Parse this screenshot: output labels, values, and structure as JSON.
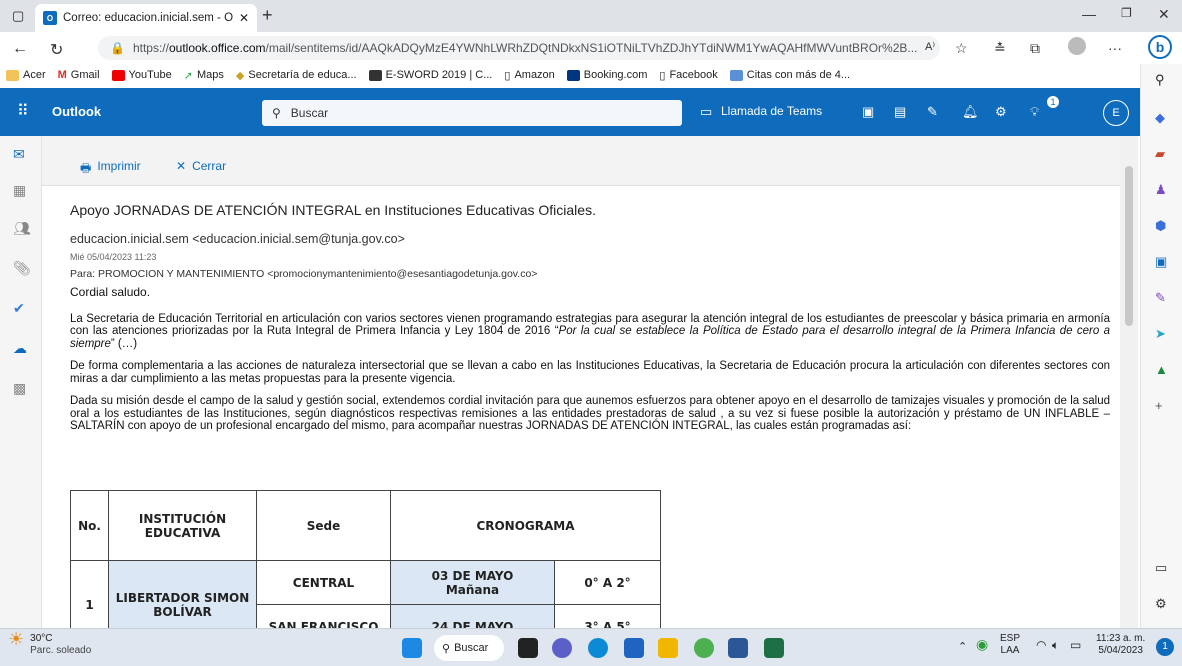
{
  "browser": {
    "tab_title": "Correo: educacion.inicial.sem - O",
    "url_prefix": "https://",
    "url_host": "outlook.office.com",
    "url_path": "/mail/sentitems/id/AAQkADQyMzE4YWNhLWRhZDQtNDkxNS1iOTNiLTVhZDJhYTdiNWM1YwAQAHfMWVuntBROr%2B...",
    "bookmarks": [
      "Acer",
      "Gmail",
      "YouTube",
      "Maps",
      "Secretaría de educa...",
      "E-SWORD 2019 | C...",
      "Amazon",
      "Booking.com",
      "Facebook",
      "Citas con más de 4..."
    ]
  },
  "outlook": {
    "brand": "Outlook",
    "search_placeholder": "Buscar",
    "teams_call": "Llamada de Teams",
    "avatar_initial": "E",
    "notif_count": "1"
  },
  "actions": {
    "print": "Imprimir",
    "close": "Cerrar"
  },
  "message": {
    "subject": "Apoyo JORNADAS DE ATENCIÓN INTEGRAL en Instituciones Educativas Oficiales.",
    "from": "educacion.inicial.sem <educacion.inicial.sem@tunja.gov.co>",
    "date": "Mié 05/04/2023 11:23",
    "to": "Para: PROMOCION Y MANTENIMIENTO <promocionymantenimiento@esesantiagodetunja.gov.co>",
    "greeting": "Cordial saludo.",
    "p1_start": "La Secretaria de Educación Territorial en articulación con varios sectores vienen programando estrategias para asegurar la atención integral de los estudiantes de preescolar y básica primaria en armonía con las atenciones priorizadas por la Ruta Integral de Primera Infancia y Ley 1804 de 2016 “",
    "p1_italic": "Por la cual se establece la Política de Estado para el desarrollo integral de la Primera Infancia de cero a siempre",
    "p1_end": "” (…)",
    "p2": "De forma complementaria a las acciones de naturaleza intersectorial que se llevan a cabo en las Instituciones Educativas, la Secretaria de Educación procura la articulación con diferentes sectores con miras a dar cumplimiento a las metas propuestas para la presente vigencia.",
    "p3": "Dada su misión desde el campo de la salud y gestión social, extendemos cordial invitación para que aunemos esfuerzos para obtener apoyo en el desarrollo de tamizajes visuales y promoción de la salud oral a los estudiantes de las Instituciones, según diagnósticos respectivas remisiones a las entidades prestadoras de salud , a su vez si fuese posible la autorización y préstamo de UN INFLABLE – SALTARÍN con apoyo de un profesional encargado del mismo, para acompañar nuestras JORNADAS DE ATENCIÓN INTEGRAL, las cuales están programadas así:"
  },
  "table": {
    "headers": [
      "No.",
      "INSTITUCIÓN EDUCATIVA",
      "Sede",
      "CRONOGRAMA"
    ],
    "row1": {
      "no": "1",
      "institucion": "LIBERTADOR SIMON BOLÍVAR",
      "sede1": "CENTRAL",
      "fecha1": "03 DE MAYO",
      "turno1": "Mañana",
      "grado1": "0° A 2°",
      "sede2": "SAN FRANCISCO",
      "fecha2": "24 DE MAYO",
      "grado2": "3° A 5°"
    }
  },
  "taskbar": {
    "temp": "30°C",
    "weather": "Parc. soleado",
    "search": "Buscar",
    "lang1": "ESP",
    "lang2": "LAA",
    "time": "11:23 a. m.",
    "date": "5/04/2023"
  }
}
